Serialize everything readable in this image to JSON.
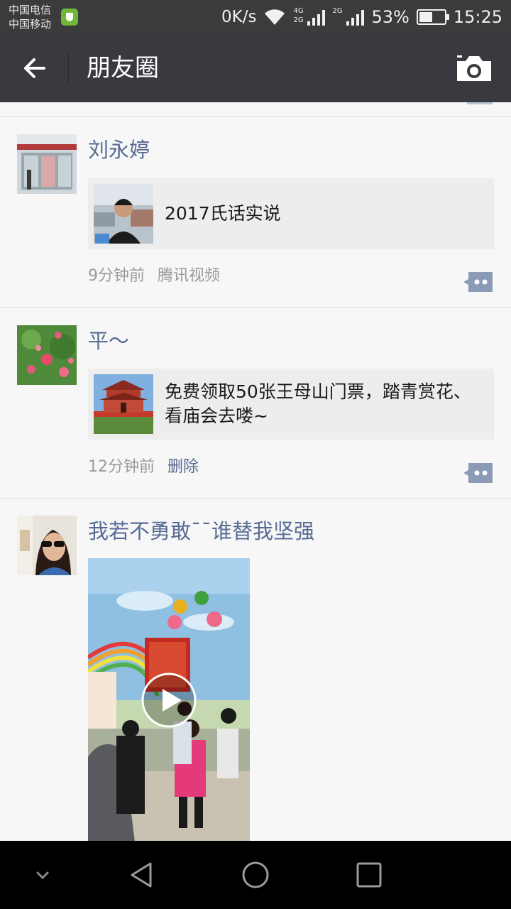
{
  "status": {
    "carrier1": "中国电信",
    "carrier2": "中国移动",
    "net_speed": "0K/s",
    "net1": "4G",
    "net2": "2G",
    "net3": "2G",
    "battery": "53%",
    "battery_level": 0.53,
    "time": "15:25"
  },
  "header": {
    "title": "朋友圈"
  },
  "posts": [
    {
      "nickname": "刘永婷",
      "link_title": "2017氏话实说",
      "time": "9分钟前",
      "source": "腾讯视频"
    },
    {
      "nickname": "平～",
      "link_title": "免费领取50张王母山门票，踏青赏花、看庙会去喽~",
      "time": "12分钟前",
      "delete": "删除"
    },
    {
      "nickname": "我若不勇敢ˉˉ谁替我坚强"
    }
  ],
  "icons": {
    "back": "arrow-left-icon",
    "camera": "camera-icon",
    "comment": "comment-dots-icon",
    "play": "play-icon",
    "nav": [
      "chevron-down-icon",
      "triangle-back-icon",
      "circle-home-icon",
      "square-recents-icon"
    ]
  },
  "colors": {
    "status_bar": "#3b3b3b",
    "title_bar": "#393a3f",
    "nickname": "#576b95",
    "card": "#ededed"
  }
}
